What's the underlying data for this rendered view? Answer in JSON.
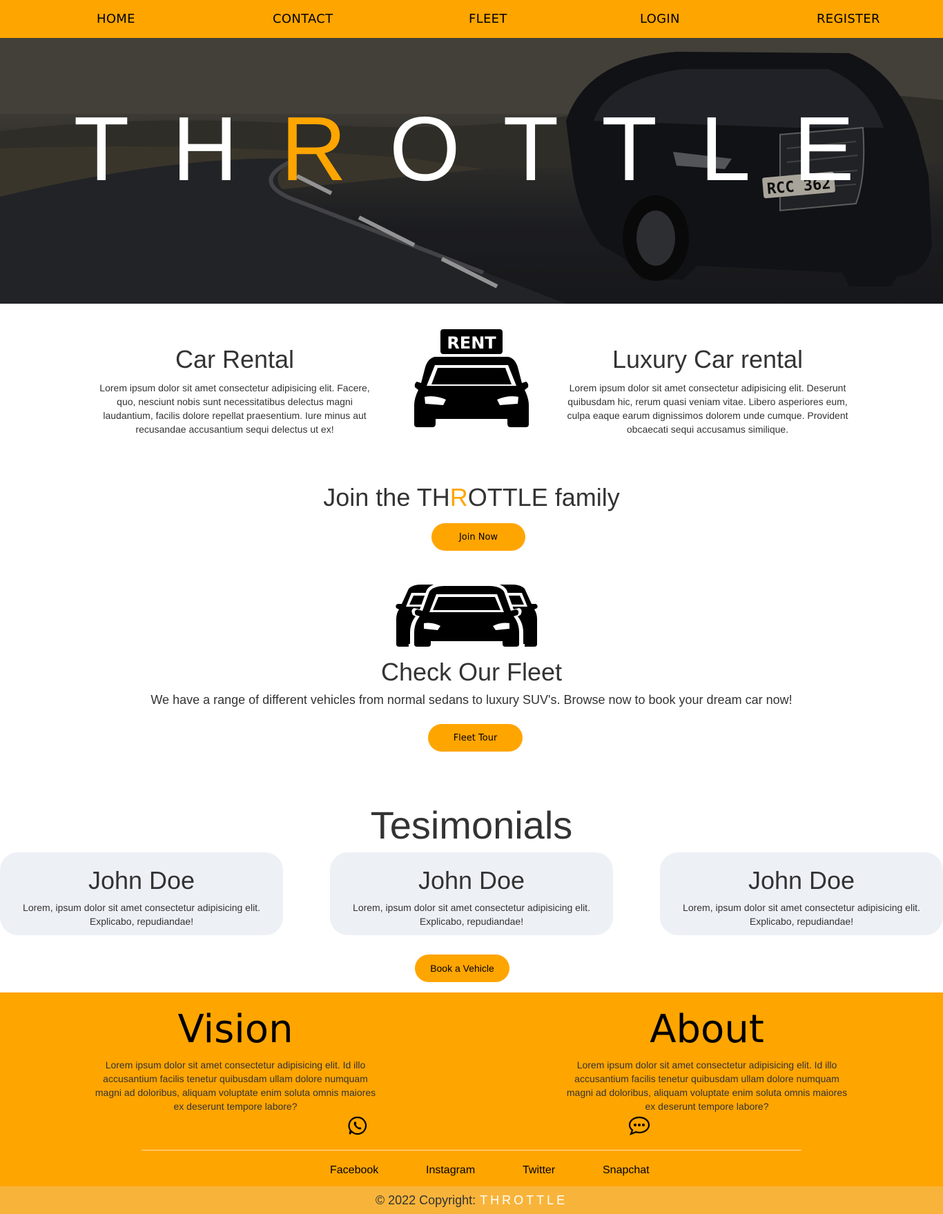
{
  "colors": {
    "accent": "#ffa500",
    "card_bg": "#edf1f6",
    "copyright_bar": "#f8b43a"
  },
  "nav": {
    "items": [
      {
        "label": "HOME"
      },
      {
        "label": "CONTACT"
      },
      {
        "label": "FLEET"
      },
      {
        "label": "LOGIN"
      },
      {
        "label": "REGISTER"
      }
    ]
  },
  "hero": {
    "title_part1": "TH",
    "title_accent": "R",
    "title_part2": "OTTLE",
    "plate": "RCC 362"
  },
  "features": {
    "left": {
      "title": "Car Rental",
      "text": "Lorem ipsum dolor sit amet consectetur adipisicing elit. Facere, quo, nesciunt nobis sunt necessitatibus delectus magni laudantium, facilis dolore repellat praesentium. Iure minus aut recusandae accusantium sequi delectus ut ex!"
    },
    "center_icon": {
      "name": "rent-car-icon",
      "sign": "RENT"
    },
    "right": {
      "title": "Luxury Car rental",
      "text": "Lorem ipsum dolor sit amet consectetur adipisicing elit. Deserunt quibusdam hic, rerum quasi veniam vitae. Libero asperiores eum, culpa eaque earum dignissimos dolorem unde cumque. Provident obcaecati sequi accusamus similique."
    }
  },
  "join": {
    "prefix": "Join the ",
    "brand_part1": "TH",
    "brand_accent": "R",
    "brand_part2": "OTTLE",
    "suffix": " family",
    "button": "Join Now"
  },
  "fleet": {
    "icon": "cars-fleet-icon",
    "title": "Check Our Fleet",
    "text": "We have a range of different vehicles from normal sedans to luxury SUV's. Browse now to book your dream car now!",
    "button": "Fleet Tour"
  },
  "testimonials": {
    "title": "Tesimonials",
    "items": [
      {
        "name": "John Doe",
        "text": "Lorem, ipsum dolor sit amet consectetur adipisicing elit. Explicabo, repudiandae!"
      },
      {
        "name": "John Doe",
        "text": "Lorem, ipsum dolor sit amet consectetur adipisicing elit. Explicabo, repudiandae!"
      },
      {
        "name": "John Doe",
        "text": "Lorem, ipsum dolor sit amet consectetur adipisicing elit. Explicabo, repudiandae!"
      }
    ],
    "button": "Book a Vehicle"
  },
  "footer": {
    "vision": {
      "title": "Vision",
      "text": "Lorem ipsum dolor sit amet consectetur adipisicing elit. Id illo accusantium facilis tenetur quibusdam ullam dolore numquam magni ad doloribus, aliquam voluptate enim soluta omnis maiores ex deserunt tempore labore?",
      "icon": "whatsapp-icon"
    },
    "about": {
      "title": "About",
      "text": "Lorem ipsum dolor sit amet consectetur adipisicing elit. Id illo accusantium facilis tenetur quibusdam ullam dolore numquam magni ad doloribus, aliquam voluptate enim soluta omnis maiores ex deserunt tempore labore?",
      "icon": "chat-bubble-icon"
    },
    "social": [
      {
        "label": "Facebook"
      },
      {
        "label": "Instagram"
      },
      {
        "label": "Twitter"
      },
      {
        "label": "Snapchat"
      }
    ],
    "copyright_prefix": "© 2022 Copyright:",
    "copyright_brand": "THROTTLE"
  }
}
